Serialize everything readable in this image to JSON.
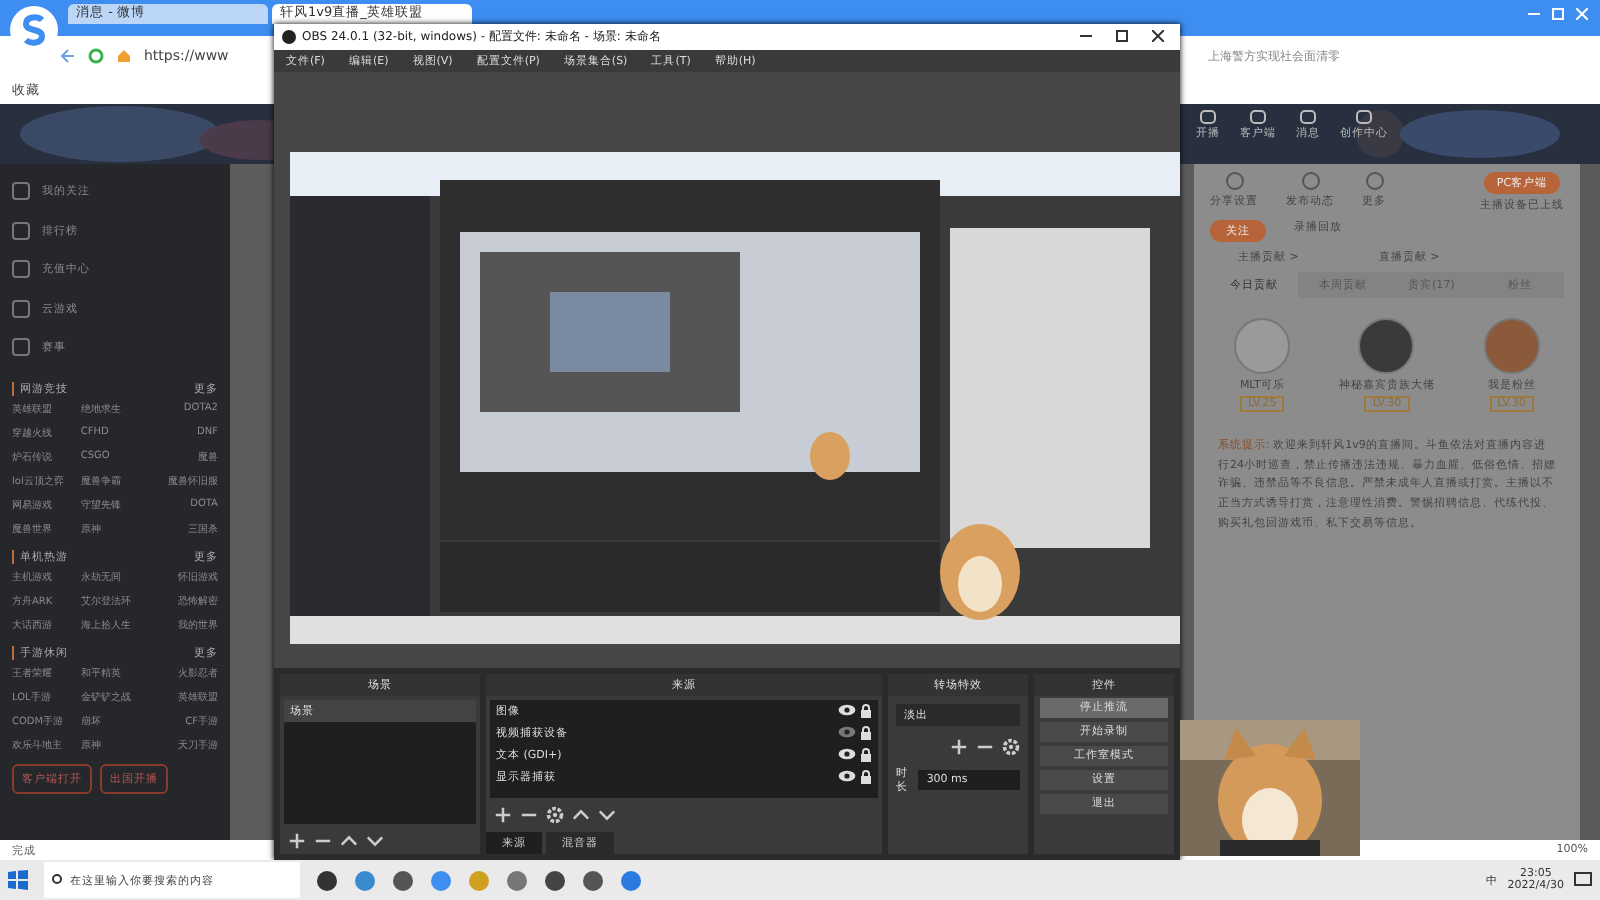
{
  "browser": {
    "tabs": [
      {
        "label": "消息 - 微博",
        "selected": false
      },
      {
        "label": "轩风1v9直播_英雄联盟",
        "selected": true
      }
    ],
    "address": "https://www",
    "search_placeholder": "上海警方实现社会面清零",
    "bookmarks": [
      "收藏"
    ],
    "header_links": [
      "开播",
      "客户端",
      "消息",
      "创作中心"
    ],
    "sidebar": {
      "nav": [
        "我的关注",
        "排行榜",
        "充值中心",
        "云游戏",
        "赛事"
      ],
      "sections": [
        {
          "title": "网游竞技",
          "more": "更多",
          "games": [
            "英雄联盟",
            "绝地求生",
            "DOTA2",
            "穿越火线",
            "CFHD",
            "DNF",
            "炉石传说",
            "CSGO",
            "魔兽",
            "lol云顶之弈",
            "魔兽争霸",
            "魔兽怀旧服",
            "网易游戏",
            "守望先锋",
            "DOTA",
            "魔兽世界",
            "原神",
            "三国杀"
          ]
        },
        {
          "title": "单机热游",
          "more": "更多",
          "games": [
            "主机游戏",
            "永劫无间",
            "怀旧游戏",
            "方舟ARK",
            "艾尔登法环",
            "恐怖解密",
            "大话西游",
            "海上拾人生",
            "我的世界"
          ]
        },
        {
          "title": "手游休闲",
          "more": "更多",
          "games": [
            "王者荣耀",
            "和平精英",
            "火影忍者",
            "LOL手游",
            "金铲铲之战",
            "英雄联盟",
            "CODM手游",
            "崩坏",
            "CF手游",
            "欢乐斗地主",
            "原神",
            "天刀手游"
          ]
        }
      ],
      "buttons": [
        "客户端打开",
        "出国开播"
      ]
    },
    "right": {
      "actions": [
        "分享设置",
        "发布动态",
        "更多"
      ],
      "client_button": "PC客户端",
      "client_note": "主播设备已上线",
      "follow": "关注",
      "replay": "录播回放",
      "rank_links": [
        "主播贡献 >",
        "直播贡献 >"
      ],
      "rank_tabs": [
        {
          "label": "今日贡献",
          "selected": true
        },
        {
          "label": "本周贡献",
          "selected": false
        },
        {
          "label": "贵宾(17)",
          "selected": false
        },
        {
          "label": "粉丝",
          "selected": false
        }
      ],
      "top_fans": [
        {
          "name": "MLT可乐",
          "level": "LV.25",
          "color": "#9a9a9a"
        },
        {
          "name": "神秘嘉宾贵族大佬",
          "level": "LV.30",
          "color": "#3a3a3a"
        },
        {
          "name": "我是粉丝",
          "level": "LV.30",
          "color": "#8a5a3a"
        }
      ],
      "notice_label": "系统提示:",
      "notice": "欢迎来到轩风1v9的直播间。斗鱼依法对直播内容进行24小时巡查，禁止传播违法违规、暴力血腥、低俗色情、招嫖诈骗、违禁品等不良信息。严禁未成年人直播或打赏。主播以不正当方式诱导打赏，注意理性消费。警惕招聘信息、代练代投、购买礼包回游戏币、私下交易等信息。"
    },
    "status": {
      "left": "完成",
      "zoom": "100%"
    }
  },
  "obs": {
    "title": "OBS 24.0.1 (32-bit, windows) - 配置文件: 未命名 - 场景: 未命名",
    "menu": [
      "文件(F)",
      "编辑(E)",
      "视图(V)",
      "配置文件(P)",
      "场景集合(S)",
      "工具(T)",
      "帮助(H)"
    ],
    "scenes": {
      "title": "场景",
      "items": [
        {
          "label": "场景",
          "selected": true
        }
      ]
    },
    "sources": {
      "title": "来源",
      "items": [
        {
          "label": "图像",
          "visible": true,
          "locked": true
        },
        {
          "label": "视频捕获设备",
          "visible": false,
          "locked": true
        },
        {
          "label": "文本 (GDI+)",
          "visible": true,
          "locked": true
        },
        {
          "label": "显示器捕获",
          "visible": true,
          "locked": true
        }
      ]
    },
    "bottom_tabs": [
      {
        "label": "来源",
        "selected": true
      },
      {
        "label": "混音器",
        "selected": false
      }
    ],
    "transitions": {
      "title": "转场特效",
      "type": "淡出",
      "duration_label": "时长",
      "duration": "300 ms"
    },
    "controls": {
      "title": "控件",
      "buttons": [
        {
          "label": "停止推流",
          "active": true
        },
        {
          "label": "开始录制",
          "active": false
        },
        {
          "label": "工作室模式",
          "active": false
        },
        {
          "label": "设置",
          "active": false
        },
        {
          "label": "退出",
          "active": false
        }
      ]
    }
  },
  "taskbar": {
    "search_placeholder": "在这里输入你要搜索的内容",
    "ime": "中",
    "time": "23:05",
    "date": "2022/4/30"
  }
}
